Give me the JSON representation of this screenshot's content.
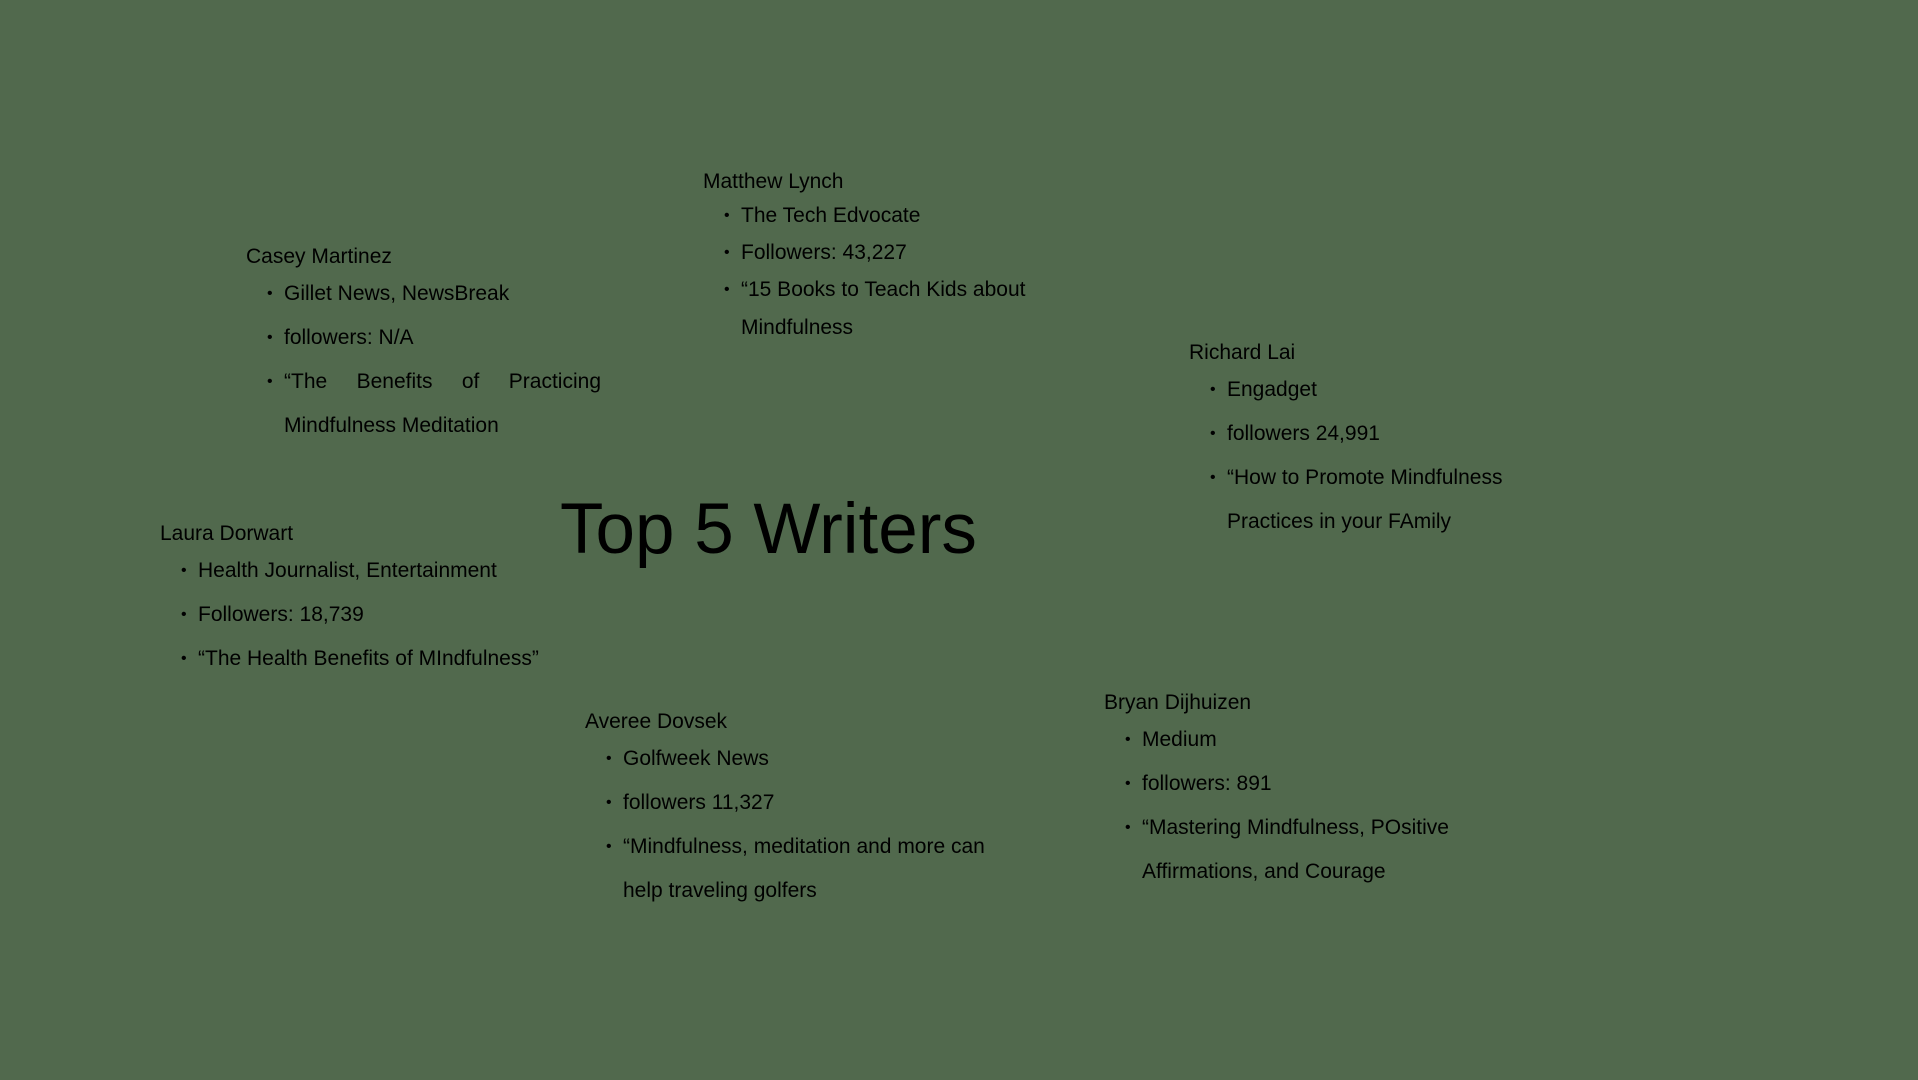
{
  "title": "Top 5 Writers",
  "writers": [
    {
      "name": "Casey Martinez",
      "items": [
        "Gillet News, NewsBreak",
        "followers: N/A",
        "“The Benefits of Practicing Mindfulness Meditation"
      ]
    },
    {
      "name": "Matthew Lynch",
      "items": [
        "The Tech Edvocate",
        "Followers: 43,227",
        "“15 Books to Teach Kids about Mindfulness"
      ]
    },
    {
      "name": "Richard Lai",
      "items": [
        "Engadget",
        "followers 24,991",
        "“How to Promote Mindfulness Practices in your FAmily"
      ]
    },
    {
      "name": "Laura Dorwart",
      "items": [
        "Health Journalist, Entertainment",
        "Followers: 18,739",
        "“The Health Benefits of MIndfulness”"
      ]
    },
    {
      "name": "Averee Dovsek",
      "items": [
        "Golfweek News",
        "followers 11,327",
        "“Mindfulness, meditation and more can help traveling golfers"
      ]
    },
    {
      "name": "Bryan Dijhuizen",
      "items": [
        "Medium",
        "followers: 891",
        "“Mastering Mindfulness, POsitive Affirmations, and Courage"
      ]
    }
  ]
}
